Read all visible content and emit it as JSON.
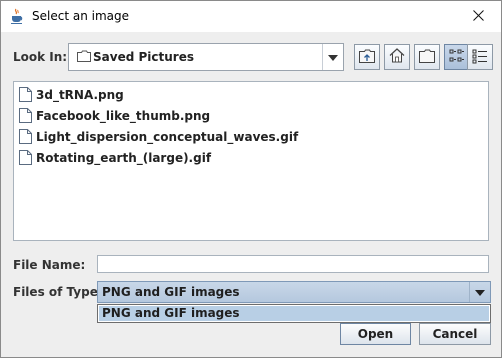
{
  "window": {
    "title": "Select an image"
  },
  "look_in": {
    "label": "Look In:",
    "value": "Saved Pictures"
  },
  "toolbar": [
    {
      "name": "up-one-level-button",
      "icon": "up-folder-icon",
      "selected": false
    },
    {
      "name": "home-button",
      "icon": "home-icon",
      "selected": false
    },
    {
      "name": "new-folder-button",
      "icon": "new-folder-icon",
      "selected": false
    },
    {
      "name": "list-view-button",
      "icon": "list-view-icon",
      "selected": true
    },
    {
      "name": "details-view-button",
      "icon": "details-view-icon",
      "selected": false
    }
  ],
  "files": [
    {
      "name": "3d_tRNA.png"
    },
    {
      "name": "Facebook_like_thumb.png"
    },
    {
      "name": "Light_dispersion_conceptual_waves.gif"
    },
    {
      "name": "Rotating_earth_(large).gif"
    }
  ],
  "file_name": {
    "label": "File Name:",
    "value": ""
  },
  "files_of_type": {
    "label": "Files of Type:",
    "value": "PNG and GIF images",
    "options": [
      "PNG and GIF images"
    ]
  },
  "buttons": {
    "open": "Open",
    "cancel": "Cancel"
  },
  "colors": {
    "selection": "#b8cfe5",
    "combo_selected": "#c8d7e8",
    "panel": "#eeeeee"
  }
}
